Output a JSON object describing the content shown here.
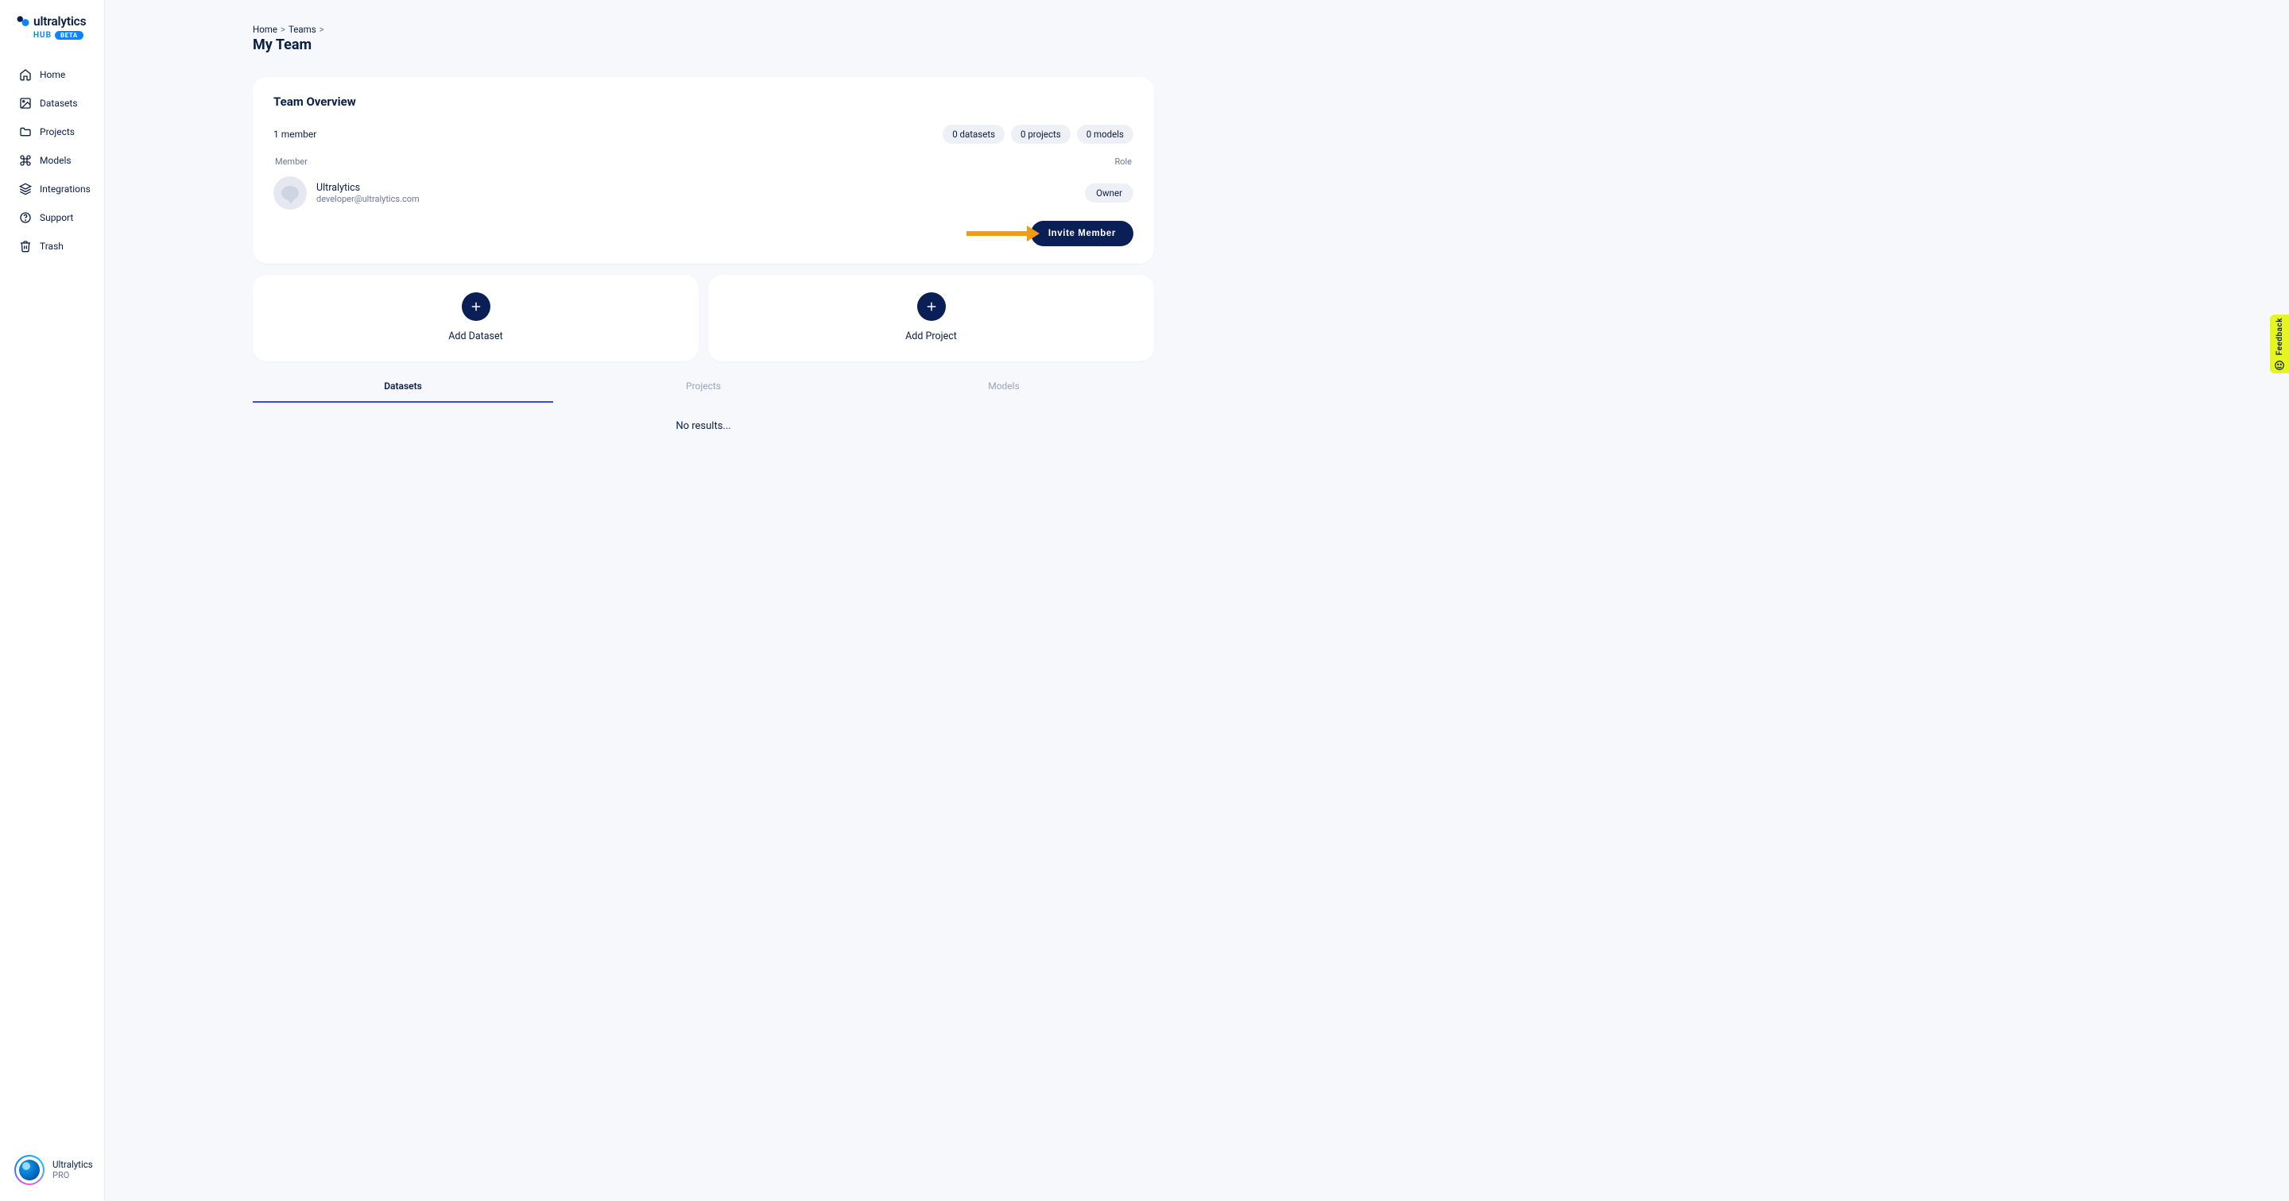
{
  "brand": {
    "name": "ultralytics",
    "hub": "HUB",
    "beta": "BETA"
  },
  "sidebar": {
    "items": [
      {
        "label": "Home",
        "icon": "home-icon"
      },
      {
        "label": "Datasets",
        "icon": "image-icon"
      },
      {
        "label": "Projects",
        "icon": "folder-icon"
      },
      {
        "label": "Models",
        "icon": "command-icon"
      },
      {
        "label": "Integrations",
        "icon": "layers-icon"
      },
      {
        "label": "Support",
        "icon": "help-icon"
      },
      {
        "label": "Trash",
        "icon": "trash-icon"
      }
    ],
    "user": {
      "name": "Ultralytics",
      "plan": "PRO"
    }
  },
  "breadcrumbs": {
    "items": [
      "Home",
      "Teams"
    ],
    "sep": ">"
  },
  "page": {
    "title": "My Team"
  },
  "overview": {
    "title": "Team Overview",
    "member_count": "1 member",
    "stats": [
      "0 datasets",
      "0 projects",
      "0 models"
    ],
    "columns": {
      "left": "Member",
      "right": "Role"
    },
    "members": [
      {
        "name": "Ultralytics",
        "email": "developer@ultralytics.com",
        "role": "Owner"
      }
    ],
    "invite_label": "Invite Member"
  },
  "add_cards": [
    {
      "label": "Add Dataset"
    },
    {
      "label": "Add Project"
    }
  ],
  "tabs": {
    "items": [
      "Datasets",
      "Projects",
      "Models"
    ],
    "active": 0
  },
  "empty": "No results...",
  "feedback": {
    "label": "Feedback"
  }
}
